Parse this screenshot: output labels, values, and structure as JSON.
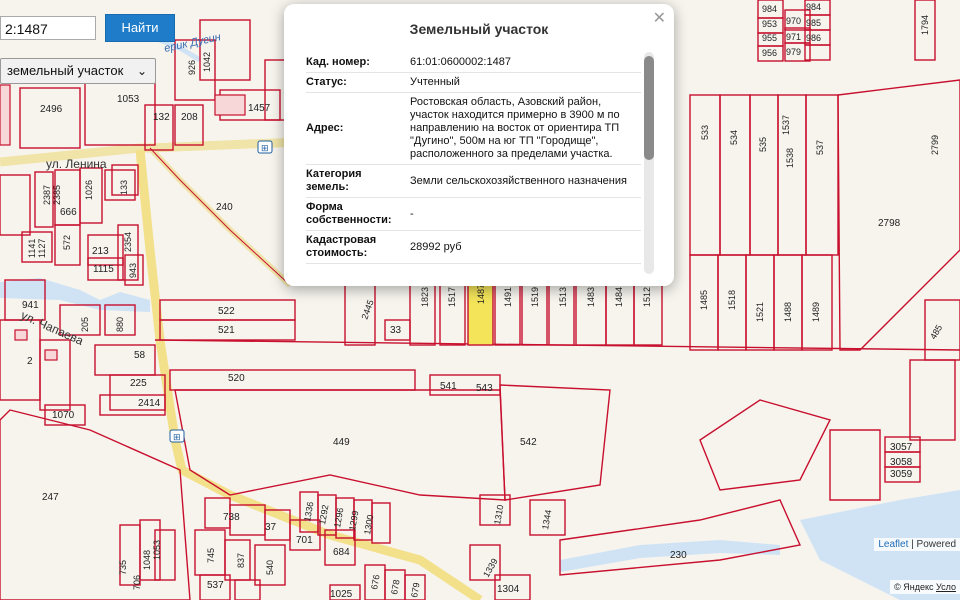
{
  "search": {
    "value": "2:1487",
    "button_label": "Найти"
  },
  "layer_select": {
    "selected": "земельный участок",
    "icon": "chevron-down-icon"
  },
  "map": {
    "streets": [
      "ул. Ленина",
      "ул. Чапаева"
    ],
    "river": "ерик Дугин",
    "parcels": [
      "2496",
      "1053",
      "1457",
      "1042",
      "926",
      "208",
      "132",
      "240",
      "2387",
      "1026",
      "133",
      "666",
      "2385",
      "572",
      "213",
      "1141",
      "1127",
      "2354",
      "1115",
      "943",
      "941",
      "522",
      "521",
      "205",
      "880",
      "58",
      "225",
      "520",
      "541",
      "543",
      "2414",
      "1070",
      "449",
      "542",
      "247",
      "738",
      "37",
      "701",
      "684",
      "1336",
      "1292",
      "1296",
      "1299",
      "1300",
      "1310",
      "1344",
      "1339",
      "1304",
      "230",
      "745",
      "837",
      "540",
      "537",
      "1025",
      "676",
      "678",
      "679",
      "2445",
      "33",
      "1823",
      "1517",
      "1491",
      "1519",
      "1513",
      "1483",
      "1484",
      "1512",
      "1485",
      "1518",
      "1521",
      "1488",
      "1489",
      "533",
      "534",
      "535",
      "1538",
      "537",
      "1537",
      "2799",
      "2798",
      "485",
      "3057",
      "3058",
      "3059",
      "1794",
      "984",
      "985",
      "953",
      "970",
      "986",
      "955",
      "971",
      "956",
      "979",
      "2",
      "1053",
      "1048",
      "735",
      "706"
    ],
    "selected_parcel": "1487"
  },
  "popup": {
    "title": "Земельный участок",
    "close_icon": "close-icon",
    "rows": [
      {
        "key": "Кад. номер:",
        "value": "61:01:0600002:1487"
      },
      {
        "key": "Статус:",
        "value": "Учтенный"
      },
      {
        "key": "Адрес:",
        "value": "Ростовская область, Азовский район, участок находится примерно в 3900 м по направлению на восток от ориентира ТП \"Дугино\", 500м на юг ТП \"Городище\", расположенного за пределами участка."
      },
      {
        "key": "Категория земель:",
        "value": "Земли сельскохозяйственного назначения"
      },
      {
        "key": "Форма собственности:",
        "value": "-"
      },
      {
        "key": "Кадастровая стоимость:",
        "value": "28992 руб"
      }
    ]
  },
  "attribution": {
    "leaflet": "Leaflet",
    "sep": " | ",
    "powered": "Powered",
    "yandex": "© Яндекс",
    "terms": "Усло"
  },
  "colors": {
    "parcel_border": "#c8102e",
    "road": "#f5e9a8",
    "selected": "#f4e45a",
    "button": "#1f7cc9",
    "water": "#cfe3f5"
  }
}
